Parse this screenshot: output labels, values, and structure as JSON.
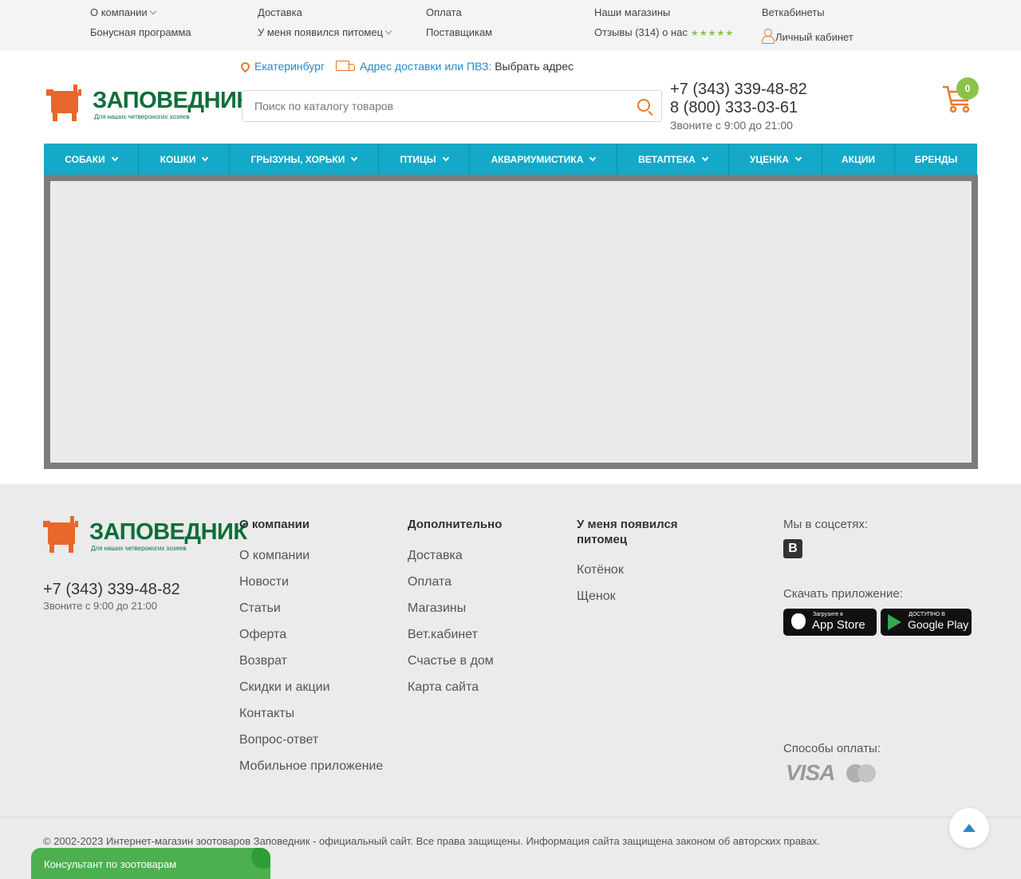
{
  "topbar": {
    "col1": [
      "О компании",
      "Бонусная программа"
    ],
    "col2": [
      "Доставка",
      "У меня появился питомец"
    ],
    "col3": [
      "Оплата",
      "Поставщикам"
    ],
    "col4": [
      "Наши магазины",
      "Отзывы (314) о нас"
    ],
    "col5": [
      "Веткабинеты",
      "Личный кабинет"
    ],
    "stars": "★★★★★",
    "rating": 5
  },
  "location": {
    "city": "Екатеринбург",
    "delivery_label": "Адрес доставки или ПВЗ:",
    "choose": "Выбрать адрес"
  },
  "logo": {
    "brand": "ЗАПОВЕДНИК",
    "tagline": "Для наших четвероногих хозяев"
  },
  "search": {
    "placeholder": "Поиск по каталогу товаров",
    "value": ""
  },
  "header": {
    "phone1": "+7 (343) 339-48-82",
    "phone2": "8 (800) 333-03-61",
    "hours": "Звоните с 9:00 до 21:00",
    "cart_count": "0"
  },
  "nav": [
    {
      "label": "СОБАКИ"
    },
    {
      "label": "КОШКИ"
    },
    {
      "label": "ГРЫЗУНЫ, ХОРЬКИ"
    },
    {
      "label": "ПТИЦЫ"
    },
    {
      "label": "АКВАРИУМИСТИКА"
    },
    {
      "label": "ВЕТАПТЕКА"
    },
    {
      "label": "УЦЕНКА"
    },
    {
      "label": "АКЦИИ"
    },
    {
      "label": "БРЕНДЫ"
    }
  ],
  "footer": {
    "phone": "+7 (343) 339-48-82",
    "hours": "Звоните с 9:00 до 21:00",
    "about": {
      "title": "О компании",
      "links": [
        "О компании",
        "Новости",
        "Статьи",
        "Оферта",
        "Возврат",
        "Скидки и акции",
        "Контакты",
        "Вопрос-ответ",
        "Мобильное приложение"
      ]
    },
    "extra": {
      "title": "Дополнительно",
      "links": [
        "Доставка",
        "Оплата",
        "Магазины",
        "Вет.кабинет",
        "Счастье в дом",
        "Карта сайта"
      ]
    },
    "pet": {
      "title": "У меня появился питомец",
      "links": [
        "Котёнок",
        "Щенок"
      ]
    },
    "social_label": "Мы в соцсетях:",
    "vk": "В",
    "app_label": "Скачать приложение:",
    "appstore_small": "Загрузите в",
    "appstore_big": "App Store",
    "gplay_small": "ДОСТУПНО В",
    "gplay_big": "Google Play",
    "payment_label": "Способы оплаты:",
    "visa": "VISA",
    "copyright": "© 2002-2023 Интернет-магазин зоотоваров Заповедник - официальный сайт. Все права защищены. Информация сайта защищена законом об авторских правах."
  },
  "consult": "Консультант по зоотоварам",
  "colors": {
    "accent_orange": "#e87a2e",
    "brand_green": "#0d6e3a",
    "nav_blue": "#14a9c8",
    "badge_green": "#8bc34a",
    "link_blue": "#2b88c5"
  }
}
